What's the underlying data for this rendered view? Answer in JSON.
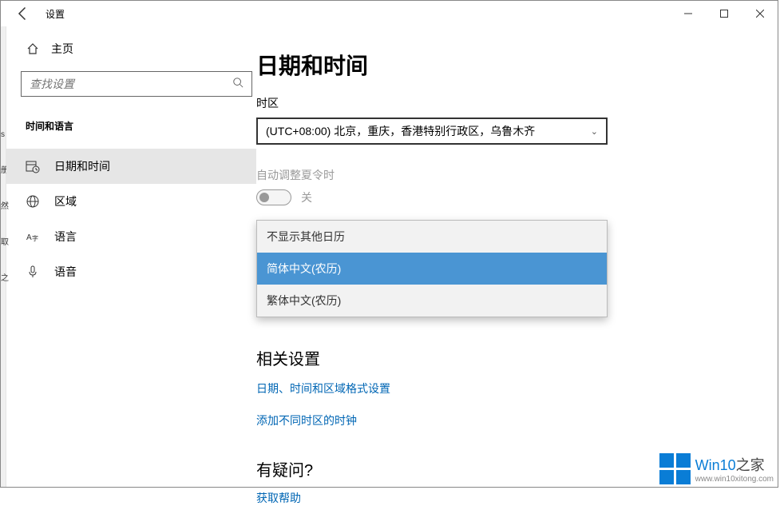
{
  "titlebar": {
    "title": "设置"
  },
  "sidebar": {
    "home": "主页",
    "search_placeholder": "查找设置",
    "category": "时间和语言",
    "items": [
      {
        "label": "日期和时间"
      },
      {
        "label": "区域"
      },
      {
        "label": "语言"
      },
      {
        "label": "语音"
      }
    ]
  },
  "main": {
    "title": "日期和时间",
    "timezone_label": "时区",
    "timezone_value": "(UTC+08:00) 北京，重庆，香港特别行政区，乌鲁木齐",
    "dst_label": "自动调整夏令时",
    "dst_state": "关",
    "calendar_options": [
      "不显示其他日历",
      "简体中文(农历)",
      "繁体中文(农历)"
    ],
    "related_title": "相关设置",
    "related_links": [
      "日期、时间和区域格式设置",
      "添加不同时区的时钟"
    ],
    "help_title": "有疑问?",
    "help_link": "获取帮助"
  },
  "watermark": {
    "brand_a": "Win10",
    "brand_b": "之家",
    "url": "www.win10xitong.com"
  }
}
